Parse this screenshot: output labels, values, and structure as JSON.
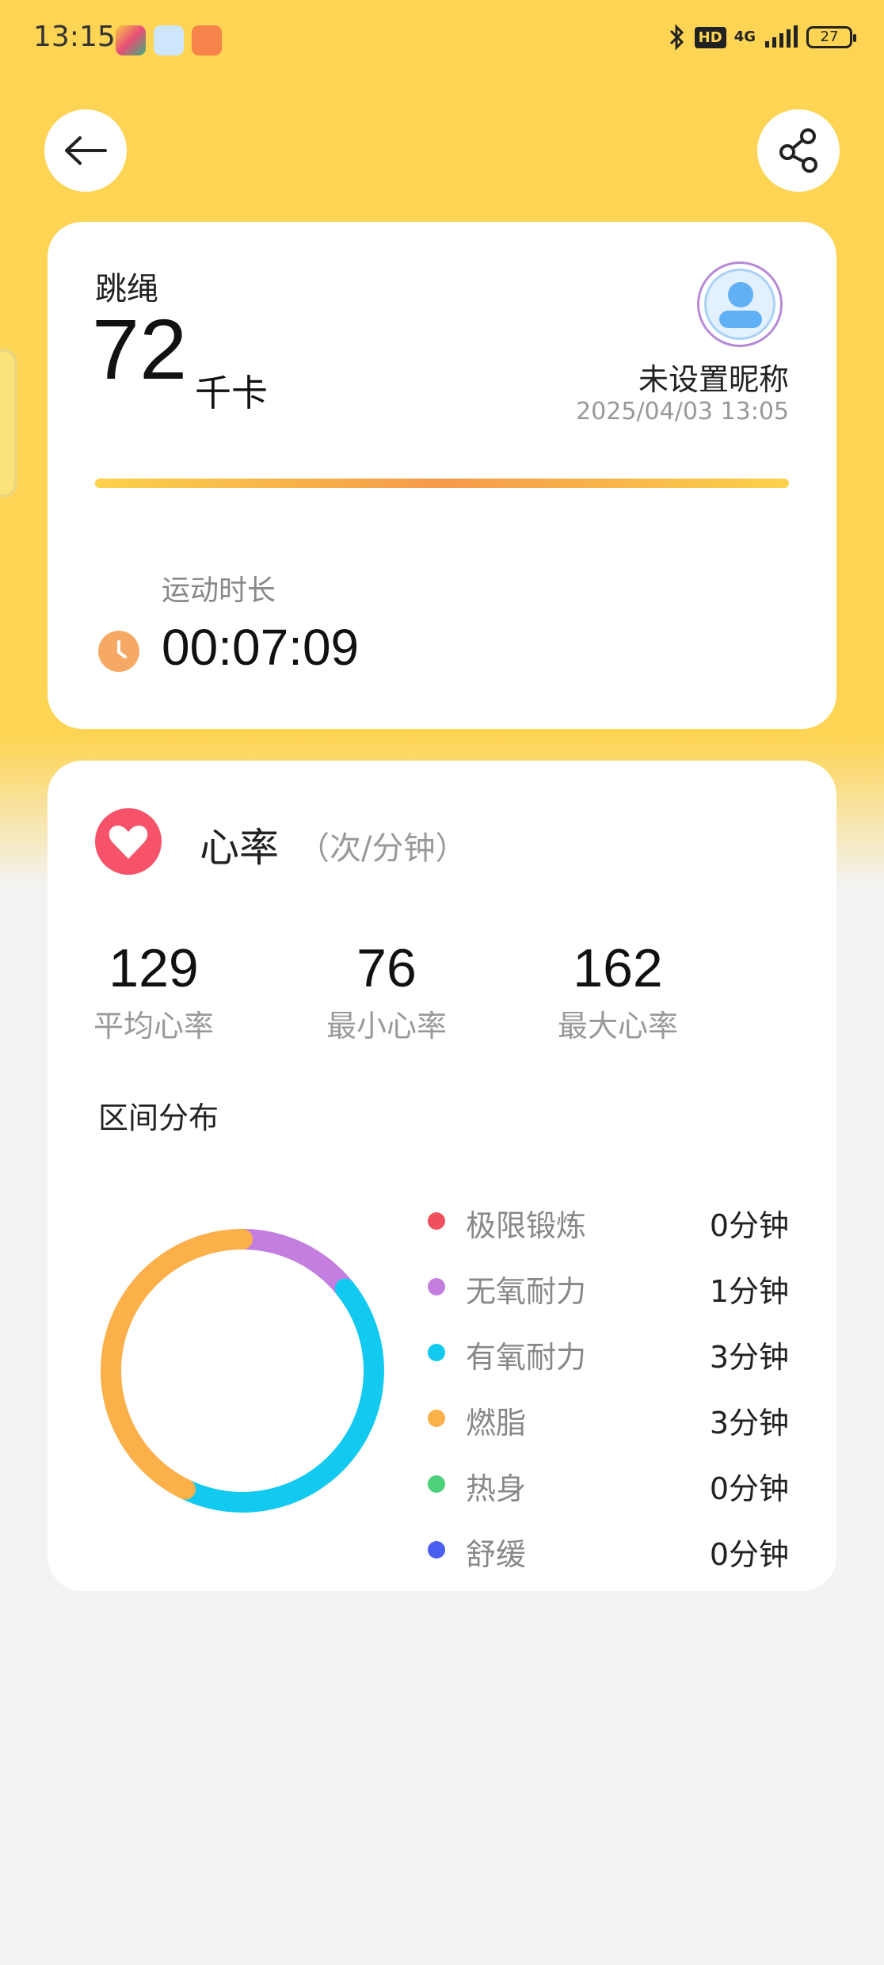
{
  "status_bar": {
    "time": "13:15",
    "hd": "HD",
    "network": "4G",
    "battery": "27"
  },
  "workout": {
    "sport": "跳绳",
    "calories": "72",
    "calories_unit": "千卡",
    "nickname": "未设置昵称",
    "datetime": "2025/04/03 13:05",
    "duration_label": "运动时长",
    "duration": "00:07:09"
  },
  "heart_rate": {
    "title": "心率",
    "unit": "（次/分钟）",
    "stats": [
      {
        "value": "129",
        "label": "平均心率"
      },
      {
        "value": "76",
        "label": "最小心率"
      },
      {
        "value": "162",
        "label": "最大心率"
      }
    ],
    "zone_title": "区间分布",
    "zones": [
      {
        "label": "极限锻炼",
        "value": "0分钟",
        "minutes": 0,
        "color": "#f0505c"
      },
      {
        "label": "无氧耐力",
        "value": "1分钟",
        "minutes": 1,
        "color": "#c47ee0"
      },
      {
        "label": "有氧耐力",
        "value": "3分钟",
        "minutes": 3,
        "color": "#12c9f0"
      },
      {
        "label": "燃脂",
        "value": "3分钟",
        "minutes": 3,
        "color": "#fbb04a"
      },
      {
        "label": "热身",
        "value": "0分钟",
        "minutes": 0,
        "color": "#4cd07a"
      },
      {
        "label": "舒缓",
        "value": "0分钟",
        "minutes": 0,
        "color": "#4a5ef0"
      }
    ]
  },
  "colors": {
    "background_top": "#fdd454",
    "accent_orange": "#f59a4a",
    "heart_red": "#f6526a"
  }
}
